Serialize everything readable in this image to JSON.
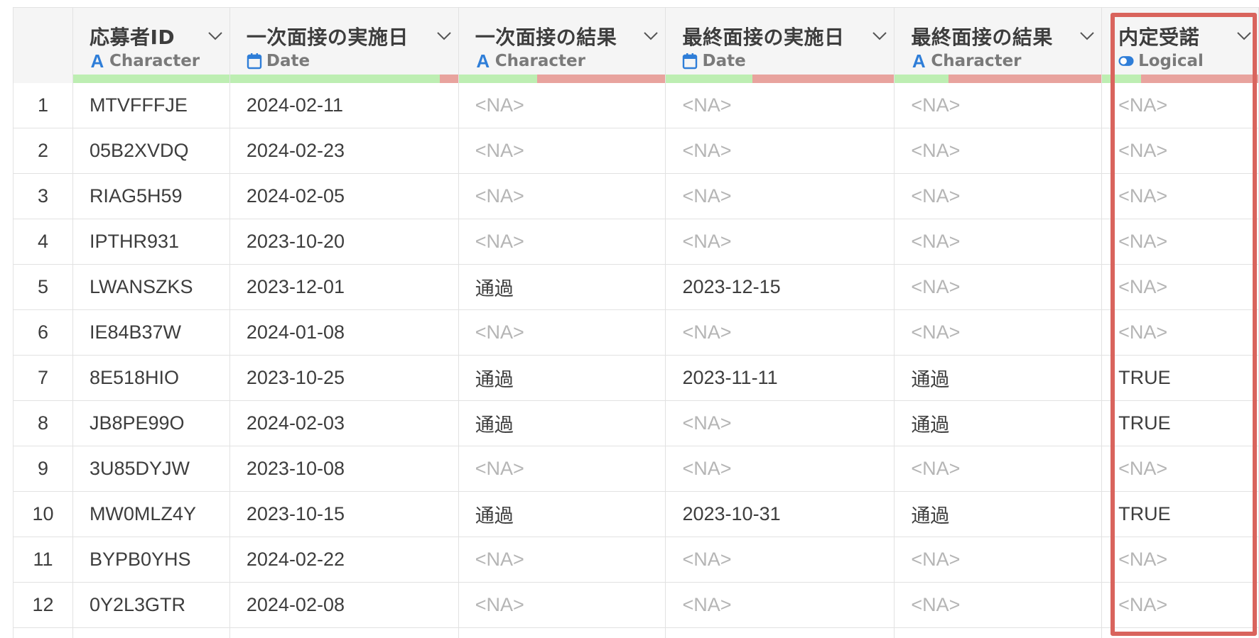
{
  "columns": [
    {
      "name": "応募者ID",
      "type": "Character",
      "type_icon": "character-icon",
      "ok_ratio": 1.0
    },
    {
      "name": "一次面接の実施日",
      "type": "Date",
      "type_icon": "calendar-icon",
      "ok_ratio": 0.92
    },
    {
      "name": "一次面接の結果",
      "type": "Character",
      "type_icon": "character-icon",
      "ok_ratio": 0.38
    },
    {
      "name": "最終面接の実施日",
      "type": "Date",
      "type_icon": "calendar-icon",
      "ok_ratio": 0.38
    },
    {
      "name": "最終面接の結果",
      "type": "Character",
      "type_icon": "character-icon",
      "ok_ratio": 0.26
    },
    {
      "name": "内定受諾",
      "type": "Logical",
      "type_icon": "toggle-icon",
      "ok_ratio": 0.25
    }
  ],
  "rows": [
    {
      "n": "1",
      "cells": [
        "MTVFFFJE",
        "2024-02-11",
        "<NA>",
        "<NA>",
        "<NA>",
        "<NA>"
      ]
    },
    {
      "n": "2",
      "cells": [
        "05B2XVDQ",
        "2024-02-23",
        "<NA>",
        "<NA>",
        "<NA>",
        "<NA>"
      ]
    },
    {
      "n": "3",
      "cells": [
        "RIAG5H59",
        "2024-02-05",
        "<NA>",
        "<NA>",
        "<NA>",
        "<NA>"
      ]
    },
    {
      "n": "4",
      "cells": [
        "IPTHR931",
        "2023-10-20",
        "<NA>",
        "<NA>",
        "<NA>",
        "<NA>"
      ]
    },
    {
      "n": "5",
      "cells": [
        "LWANSZKS",
        "2023-12-01",
        "通過",
        "2023-12-15",
        "<NA>",
        "<NA>"
      ]
    },
    {
      "n": "6",
      "cells": [
        "IE84B37W",
        "2024-01-08",
        "<NA>",
        "<NA>",
        "<NA>",
        "<NA>"
      ]
    },
    {
      "n": "7",
      "cells": [
        "8E518HIO",
        "2023-10-25",
        "通過",
        "2023-11-11",
        "通過",
        "TRUE"
      ]
    },
    {
      "n": "8",
      "cells": [
        "JB8PE99O",
        "2024-02-03",
        "通過",
        "<NA>",
        "通過",
        "TRUE"
      ]
    },
    {
      "n": "9",
      "cells": [
        "3U85DYJW",
        "2023-10-08",
        "<NA>",
        "<NA>",
        "<NA>",
        "<NA>"
      ]
    },
    {
      "n": "10",
      "cells": [
        "MW0MLZ4Y",
        "2023-10-15",
        "通過",
        "2023-10-31",
        "通過",
        "TRUE"
      ]
    },
    {
      "n": "11",
      "cells": [
        "BYPB0YHS",
        "2024-02-22",
        "<NA>",
        "<NA>",
        "<NA>",
        "<NA>"
      ]
    },
    {
      "n": "12",
      "cells": [
        "0Y2L3GTR",
        "2024-02-08",
        "<NA>",
        "<NA>",
        "<NA>",
        "<NA>"
      ]
    }
  ],
  "colors": {
    "ok_bar": "#bdeeb2",
    "na_bar": "#e8a39e",
    "highlight": "#d9645d",
    "type_icon": "#2f7ed8"
  },
  "highlighted_column": "内定受諾"
}
